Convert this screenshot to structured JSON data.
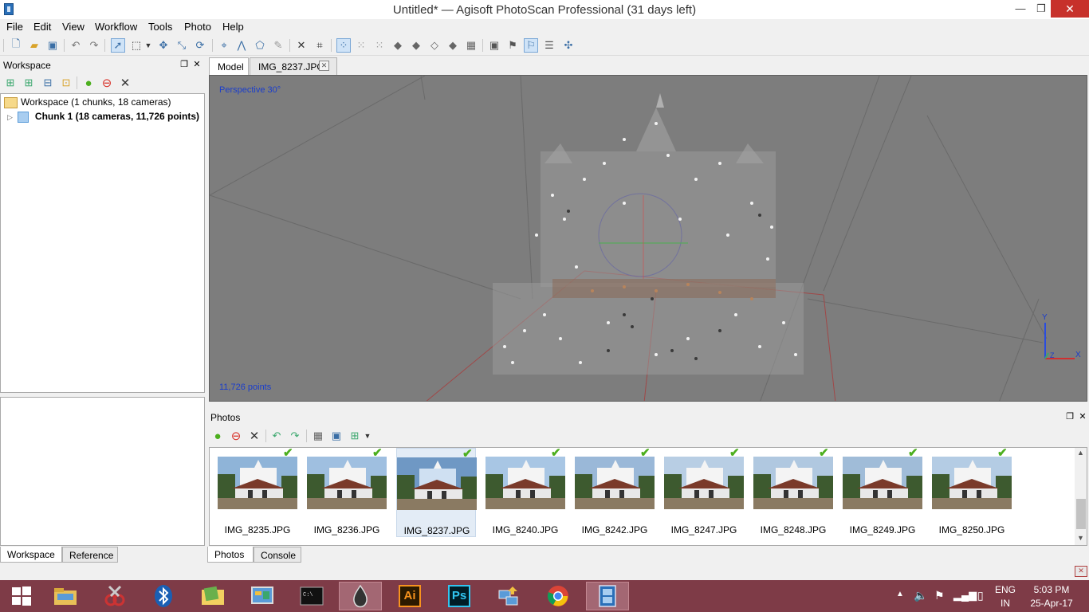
{
  "window": {
    "title": "Untitled* — Agisoft PhotoScan Professional (31 days left)",
    "minimize": "—",
    "maximize": "❐",
    "close": "✕"
  },
  "menu": [
    "File",
    "Edit",
    "View",
    "Workflow",
    "Tools",
    "Photo",
    "Help"
  ],
  "workspace": {
    "header": "Workspace",
    "root_label": "Workspace (1 chunks, 18 cameras)",
    "chunk_label": "Chunk 1 (18 cameras, 11,726 points)",
    "tabs": [
      "Workspace",
      "Reference"
    ]
  },
  "model_view": {
    "tabs": [
      "Model",
      "IMG_8237.JPG"
    ],
    "projection": "Perspective 30°",
    "points_label": "11,726 points",
    "axis_labels": {
      "y": "Y",
      "x": "X",
      "z": "Z"
    }
  },
  "photos": {
    "header": "Photos",
    "items": [
      {
        "name": "IMG_8235.JPG",
        "aligned": true,
        "selected": false
      },
      {
        "name": "IMG_8236.JPG",
        "aligned": true,
        "selected": false
      },
      {
        "name": "IMG_8237.JPG",
        "aligned": true,
        "selected": true
      },
      {
        "name": "IMG_8240.JPG",
        "aligned": true,
        "selected": false
      },
      {
        "name": "IMG_8242.JPG",
        "aligned": true,
        "selected": false
      },
      {
        "name": "IMG_8247.JPG",
        "aligned": true,
        "selected": false
      },
      {
        "name": "IMG_8248.JPG",
        "aligned": true,
        "selected": false
      },
      {
        "name": "IMG_8249.JPG",
        "aligned": true,
        "selected": false
      },
      {
        "name": "IMG_8250.JPG",
        "aligned": true,
        "selected": false
      }
    ],
    "tabs": [
      "Photos",
      "Console"
    ]
  },
  "taskbar": {
    "lang_top": "ENG",
    "lang_bottom": "IN",
    "time": "5:03 PM",
    "date": "25-Apr-17",
    "apps": [
      "windows-start",
      "file-explorer",
      "snipping-tool",
      "bluetooth",
      "folder",
      "control-panel",
      "command-prompt",
      "inkscape",
      "illustrator",
      "photoshop",
      "network-tool",
      "chrome",
      "photoscan"
    ],
    "ai_label": "Ai",
    "ps_label": "Ps"
  }
}
